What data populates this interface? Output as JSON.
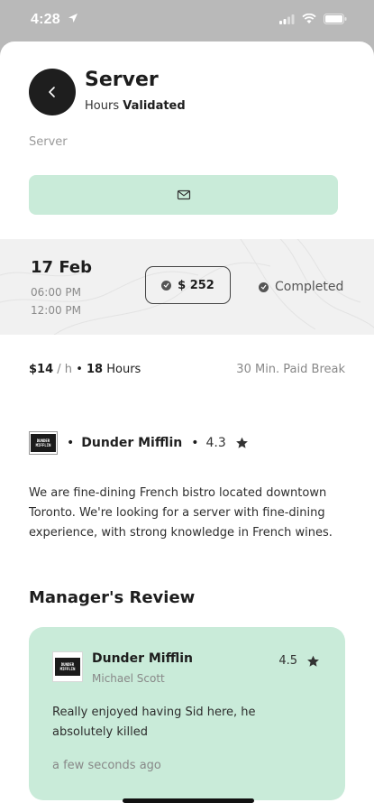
{
  "status_bar": {
    "time": "4:28"
  },
  "header": {
    "title": "Server",
    "subtitle_prefix": "Hours",
    "subtitle_status": "Validated",
    "role": "Server"
  },
  "shift": {
    "date": "17 Feb",
    "start_time": "06:00 PM",
    "end_time": "12:00 PM",
    "pay": "$ 252",
    "status": "Completed"
  },
  "info": {
    "rate": "$14",
    "rate_unit": "/ h",
    "hours_value": "18",
    "hours_label": "Hours",
    "break": "30 Min. Paid Break"
  },
  "employer": {
    "logo_text": "DUNDER MIFFLIN",
    "name": "Dunder Mifflin",
    "rating": "4.3",
    "description": "We are fine-dining French bistro located downtown Toronto. We're looking for a server with fine-dining experience, with strong knowledge in French wines."
  },
  "review": {
    "heading": "Manager's Review",
    "company": "Dunder Mifflin",
    "reviewer": "Michael Scott",
    "rating": "4.5",
    "text": "Really enjoyed having Sid here, he absolutely killed",
    "time": "a few seconds ago"
  },
  "colors": {
    "accent_green": "#c9ebd9",
    "dark": "#1e1e1e"
  },
  "icons": {
    "back": "chevron-left-icon",
    "message": "mail-icon",
    "star": "star-icon",
    "check": "check-circle-icon"
  }
}
